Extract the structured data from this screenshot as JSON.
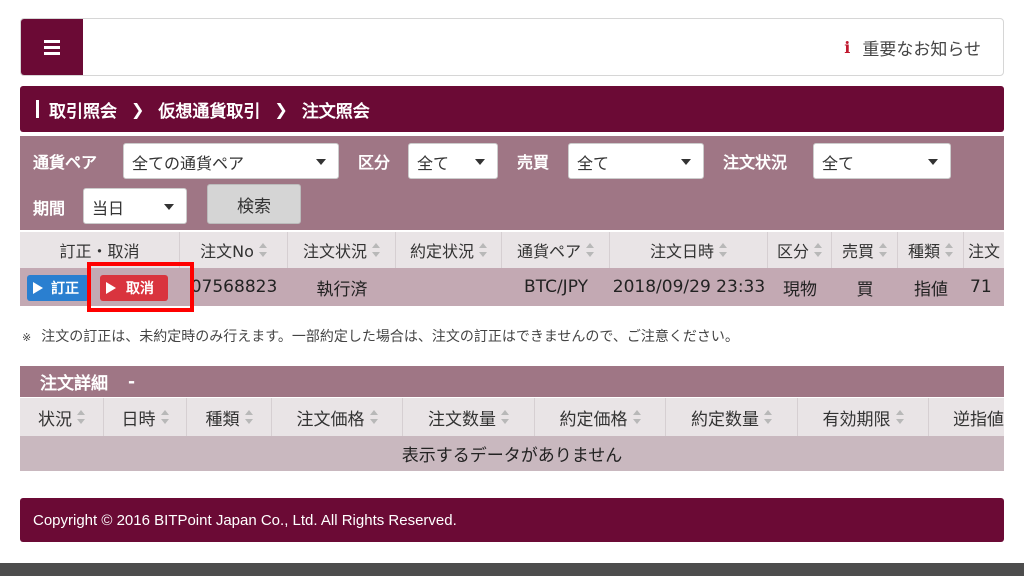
{
  "header": {
    "notice_label": "重要なお知らせ"
  },
  "breadcrumb": [
    "取引照会",
    "仮想通貨取引",
    "注文照会"
  ],
  "filters": {
    "pair_label": "通貨ペア",
    "pair_value": "全ての通貨ペア",
    "kubun_label": "区分",
    "kubun_value": "全て",
    "baibai_label": "売買",
    "baibai_value": "全て",
    "status_label": "注文状況",
    "status_value": "全て",
    "period_label": "期間",
    "period_value": "当日",
    "search_label": "検索"
  },
  "orders": {
    "columns": [
      "訂正・取消",
      "注文No",
      "注文状況",
      "約定状況",
      "通貨ペア",
      "注文日時",
      "区分",
      "売買",
      "種類",
      "注文"
    ],
    "rows": [
      {
        "edit_label": "訂正",
        "cancel_label": "取消",
        "order_no": "07568823",
        "order_status": "執行済",
        "fill_status": "",
        "pair": "BTC/JPY",
        "datetime": "2018/09/29 23:33",
        "kubun": "現物",
        "baibai": "買",
        "type": "指値",
        "price": "71"
      }
    ]
  },
  "note": {
    "mark": "※",
    "text": "注文の訂正は、未約定時のみ行えます。一部約定した場合は、注文の訂正はできませんので、ご注意ください。"
  },
  "detail": {
    "title": "注文詳細",
    "dash": "-",
    "columns": [
      "状況",
      "日時",
      "種類",
      "注文価格",
      "注文数量",
      "約定価格",
      "約定数量",
      "有効期限",
      "逆指値"
    ],
    "empty_text": "表示するデータがありません"
  },
  "footer": {
    "copyright": "Copyright © 2016 BITPoint Japan Co., Ltd. All Rights Reserved."
  },
  "colors": {
    "brand": "#6b0a35",
    "filter_bg": "#9f7685",
    "row_bg": "#c3a9b3",
    "edit_button": "#2a7fd0",
    "cancel_button": "#d9343e",
    "highlight": "#ff0000"
  }
}
